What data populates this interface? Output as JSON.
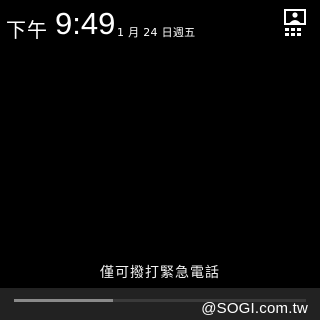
{
  "status": {
    "ampm": "下午",
    "time": "9:49",
    "date": "1 月 24 日週五"
  },
  "lockscreen": {
    "emergency_text": "僅可撥打緊急電話",
    "unlock_progress": 0.34
  },
  "watermark": "@SOGI.com.tw",
  "icons": {
    "quick_settings": "quick-settings-icon"
  }
}
